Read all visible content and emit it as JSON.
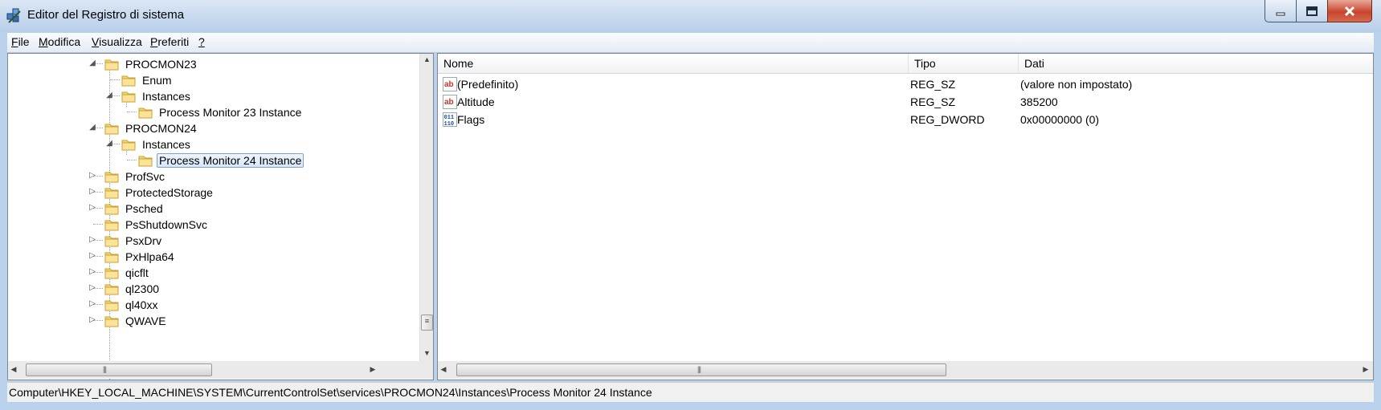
{
  "window": {
    "title": "Editor del Registro di sistema",
    "colors": {
      "frame": "#b9d1ea",
      "close_button": "#c8452c",
      "selection_border": "#7da2ce"
    }
  },
  "menu": [
    "File",
    "Modifica",
    "Visualizza",
    "Preferiti",
    "?"
  ],
  "tree": {
    "items": [
      {
        "label": "PROCMON23",
        "expander": "expanded",
        "icon": "folder-icon"
      },
      {
        "label": "Enum",
        "expander": "none",
        "icon": "folder-icon"
      },
      {
        "label": "Instances",
        "expander": "expanded",
        "icon": "folder-icon"
      },
      {
        "label": "Process Monitor 23 Instance",
        "expander": "none",
        "icon": "folder-icon"
      },
      {
        "label": "PROCMON24",
        "expander": "expanded",
        "icon": "folder-icon"
      },
      {
        "label": "Instances",
        "expander": "expanded",
        "icon": "folder-icon"
      },
      {
        "label": "Process Monitor 24 Instance",
        "expander": "none",
        "icon": "folder-icon",
        "selected": true
      },
      {
        "label": "ProfSvc",
        "expander": "collapsed",
        "icon": "folder-icon"
      },
      {
        "label": "ProtectedStorage",
        "expander": "collapsed",
        "icon": "folder-icon"
      },
      {
        "label": "Psched",
        "expander": "collapsed",
        "icon": "folder-icon"
      },
      {
        "label": "PsShutdownSvc",
        "expander": "none",
        "icon": "folder-icon"
      },
      {
        "label": "PsxDrv",
        "expander": "collapsed",
        "icon": "folder-icon"
      },
      {
        "label": "PxHlpa64",
        "expander": "collapsed",
        "icon": "folder-icon"
      },
      {
        "label": "qicflt",
        "expander": "collapsed",
        "icon": "folder-icon"
      },
      {
        "label": "ql2300",
        "expander": "collapsed",
        "icon": "folder-icon"
      },
      {
        "label": "ql40xx",
        "expander": "collapsed",
        "icon": "folder-icon"
      },
      {
        "label": "QWAVE",
        "expander": "collapsed",
        "icon": "folder-icon"
      }
    ]
  },
  "list": {
    "columns": [
      "Nome",
      "Tipo",
      "Dati"
    ],
    "rows": [
      {
        "name": "(Predefinito)",
        "type": "REG_SZ",
        "data": "(valore non impostato)",
        "icon": "string-value-icon"
      },
      {
        "name": "Altitude",
        "type": "REG_SZ",
        "data": "385200",
        "icon": "string-value-icon"
      },
      {
        "name": "Flags",
        "type": "REG_DWORD",
        "data": "0x00000000 (0)",
        "icon": "binary-value-icon"
      }
    ]
  },
  "status": {
    "path": "Computer\\HKEY_LOCAL_MACHINE\\SYSTEM\\CurrentControlSet\\services\\PROCMON24\\Instances\\Process Monitor 24 Instance"
  }
}
